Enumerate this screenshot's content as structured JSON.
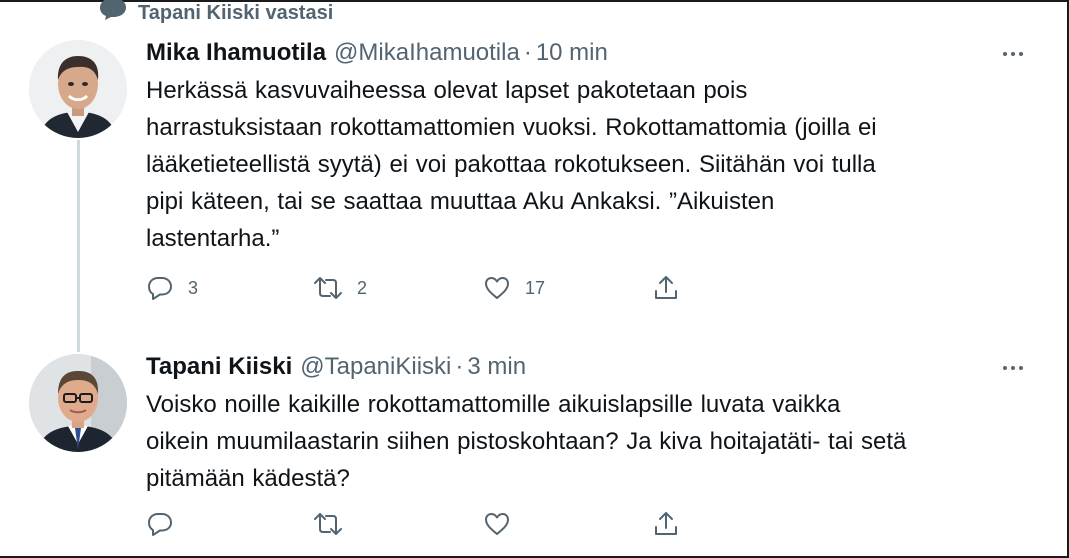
{
  "reply_context": {
    "text": "Tapani Kiiski vastasi"
  },
  "tweets": [
    {
      "name": "Mika Ihamuotila",
      "handle": "@MikaIhamuotila",
      "separator": "·",
      "time": "10 min",
      "lines": [
        "Herkässä kasvuvaiheessa olevat lapset pakotetaan pois",
        "harrastuksistaan rokottamattomien vuoksi. Rokottamattomia (joilla ei",
        "lääketieteellistä syytä) ei voi pakottaa rokotukseen. Siitähän voi tulla",
        "pipi käteen, tai se saattaa muuttaa Aku Ankaksi. ”Aikuisten",
        "lastentarha.”"
      ],
      "reply_count": "3",
      "retweet_count": "2",
      "like_count": "17"
    },
    {
      "name": "Tapani Kiiski",
      "handle": "@TapaniKiiski",
      "separator": "·",
      "time": "3 min",
      "lines": [
        "Voisko noille kaikille rokottamattomille aikuislapsille luvata vaikka",
        "oikein muumilaastarin siihen pistoskohtaan? Ja kiva hoitajatäti- tai setä",
        "pitämään kädestä?"
      ],
      "reply_count": "",
      "retweet_count": "",
      "like_count": ""
    }
  ],
  "icons": {
    "reply_context": "speech-bubble-icon",
    "more": "more-dots-icon",
    "reply": "reply-icon",
    "retweet": "retweet-icon",
    "like": "heart-icon",
    "share": "share-icon"
  },
  "colors": {
    "text_primary": "#0f1419",
    "text_secondary": "#536471",
    "thread_line": "#cfd9de",
    "background": "#ffffff"
  }
}
